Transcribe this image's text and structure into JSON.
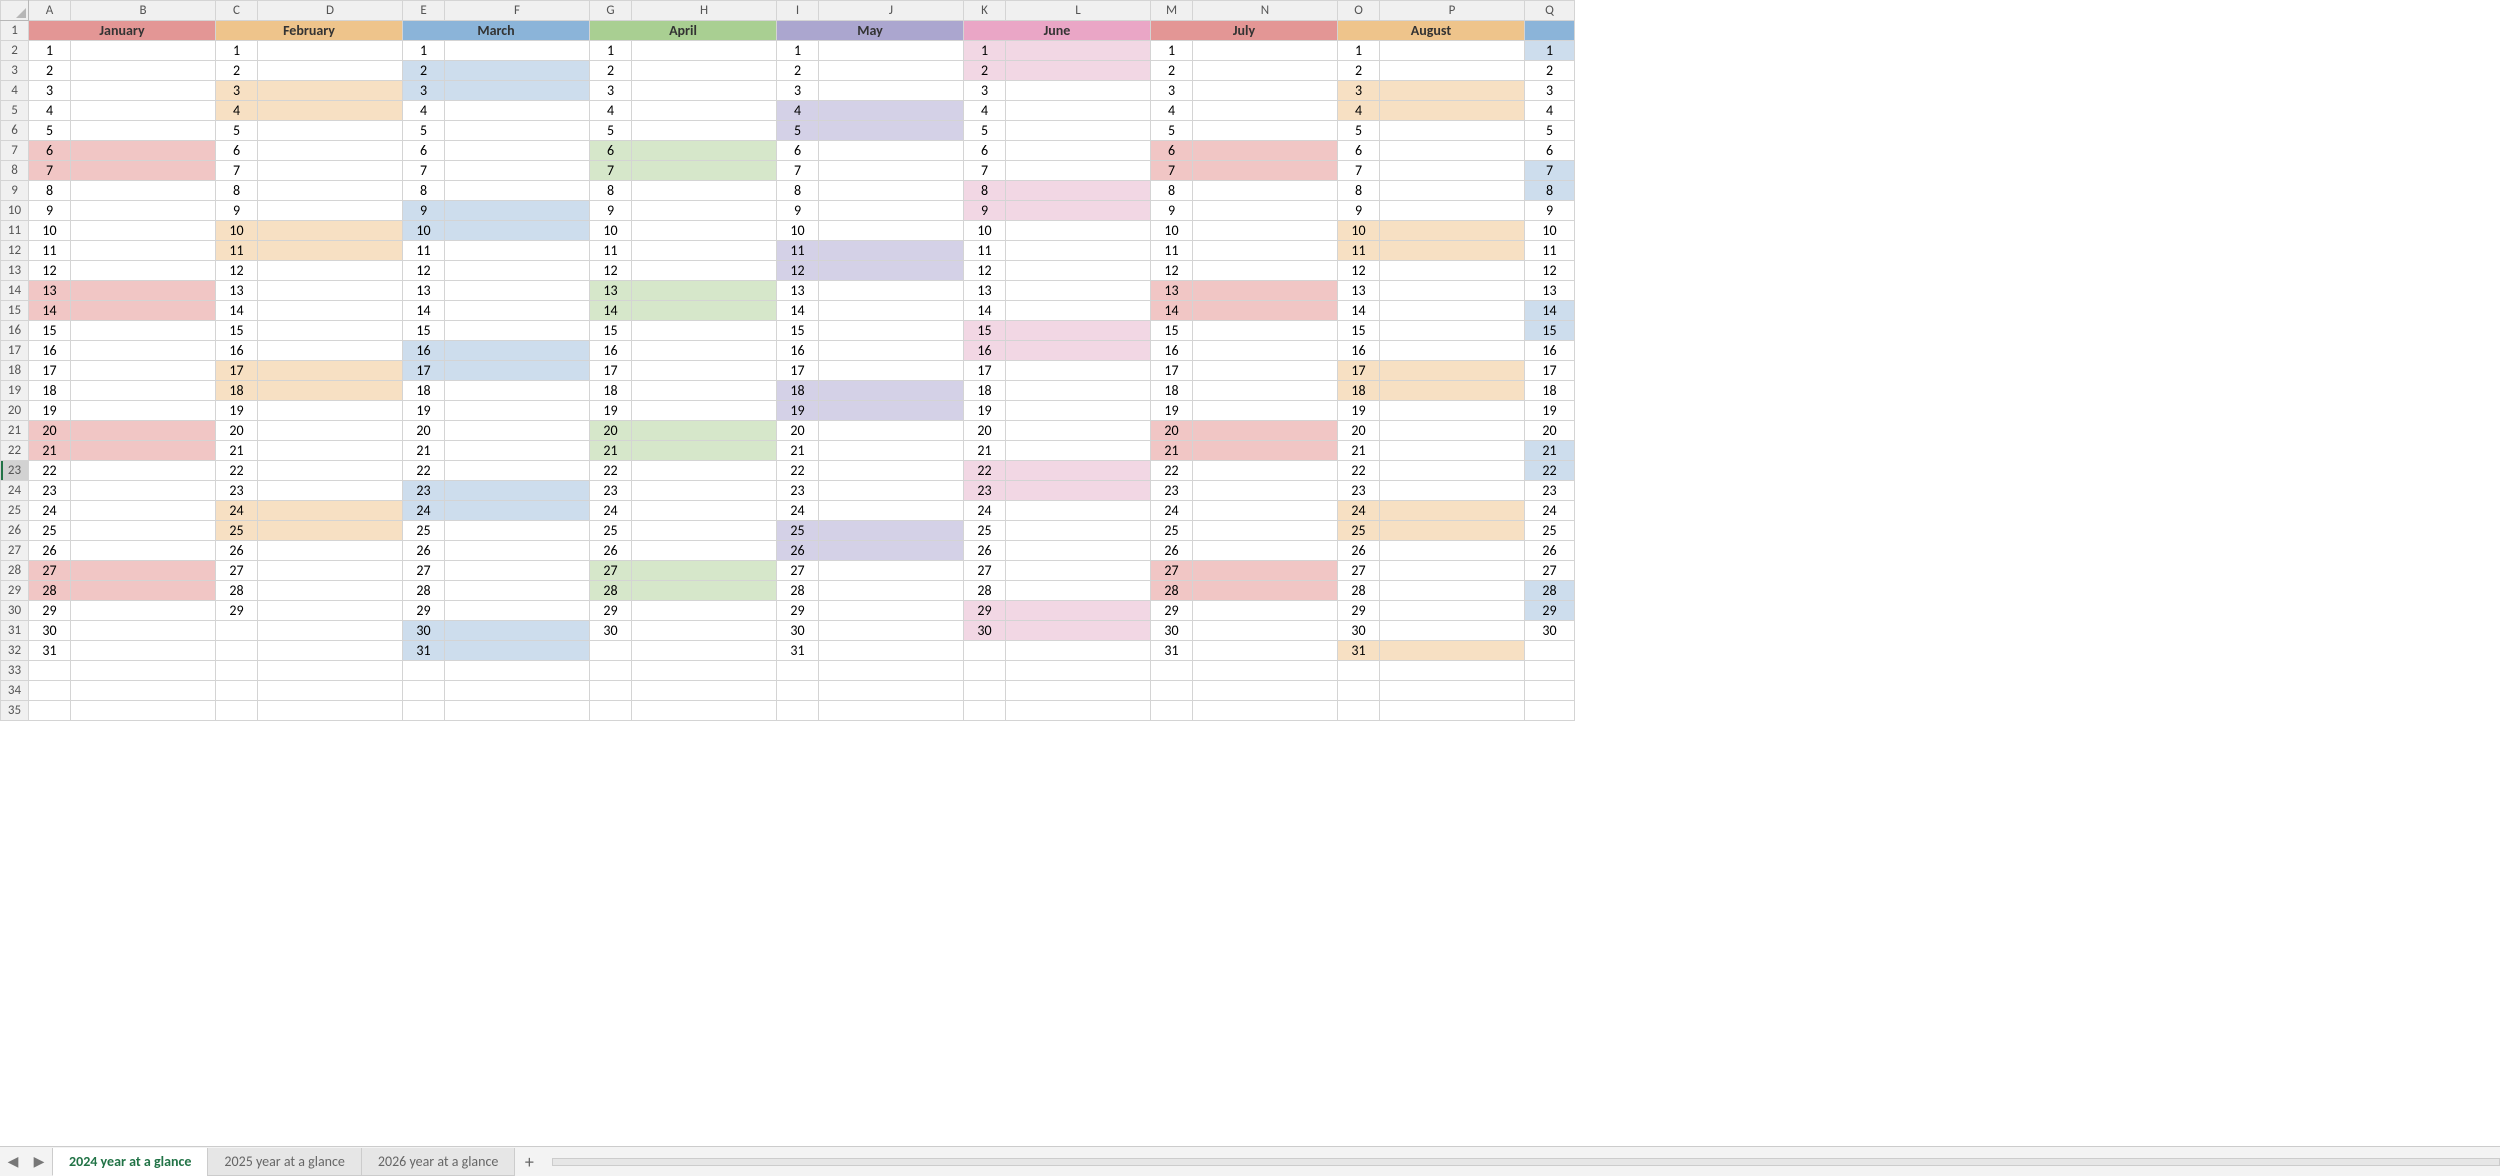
{
  "columns": [
    "A",
    "B",
    "C",
    "D",
    "E",
    "F",
    "G",
    "H",
    "I",
    "J",
    "K",
    "L",
    "M",
    "N",
    "O",
    "P",
    "Q"
  ],
  "colWidths": {
    "day": 42,
    "event": 145,
    "Q": 50
  },
  "rowCount": 35,
  "selectedRow": 23,
  "months": [
    {
      "name": "January",
      "hdrBg": "#e39695",
      "days": 31,
      "weekendBg": "#f1c6c5",
      "weekends": [
        6,
        7,
        13,
        14,
        20,
        21,
        27,
        28
      ]
    },
    {
      "name": "February",
      "hdrBg": "#eec48b",
      "days": 29,
      "weekendBg": "#f7e0c3",
      "weekends": [
        3,
        4,
        10,
        11,
        17,
        18,
        24,
        25
      ]
    },
    {
      "name": "March",
      "hdrBg": "#8bb4d9",
      "days": 31,
      "weekendBg": "#cddded",
      "weekends": [
        2,
        3,
        9,
        10,
        16,
        17,
        23,
        24,
        30,
        31
      ]
    },
    {
      "name": "April",
      "hdrBg": "#a9cf92",
      "days": 30,
      "weekendBg": "#d6e7ca",
      "weekends": [
        6,
        7,
        13,
        14,
        20,
        21,
        27,
        28
      ]
    },
    {
      "name": "May",
      "hdrBg": "#aba6cf",
      "days": 31,
      "weekendBg": "#d4d1e7",
      "weekends": [
        4,
        5,
        11,
        12,
        18,
        19,
        25,
        26
      ]
    },
    {
      "name": "June",
      "hdrBg": "#eaa6c6",
      "days": 30,
      "weekendBg": "#f2d7e4",
      "weekends": [
        1,
        2,
        8,
        9,
        15,
        16,
        22,
        23,
        29,
        30
      ]
    },
    {
      "name": "July",
      "hdrBg": "#e39695",
      "days": 31,
      "weekendBg": "#f1c6c5",
      "weekends": [
        6,
        7,
        13,
        14,
        20,
        21,
        27,
        28
      ]
    },
    {
      "name": "August",
      "hdrBg": "#eec48b",
      "days": 31,
      "weekendBg": "#f7e0c3",
      "weekends": [
        3,
        4,
        10,
        11,
        17,
        18,
        24,
        25,
        31
      ]
    }
  ],
  "extraMonth": {
    "days": 30,
    "weekendBg": "#cddded",
    "weekends": [
      1,
      7,
      8,
      14,
      15,
      21,
      22,
      28,
      29
    ]
  },
  "tabs": [
    {
      "label": "2024 year at a glance",
      "active": true
    },
    {
      "label": "2025 year at a glance",
      "active": false
    },
    {
      "label": "2026 year at a glance",
      "active": false
    }
  ]
}
